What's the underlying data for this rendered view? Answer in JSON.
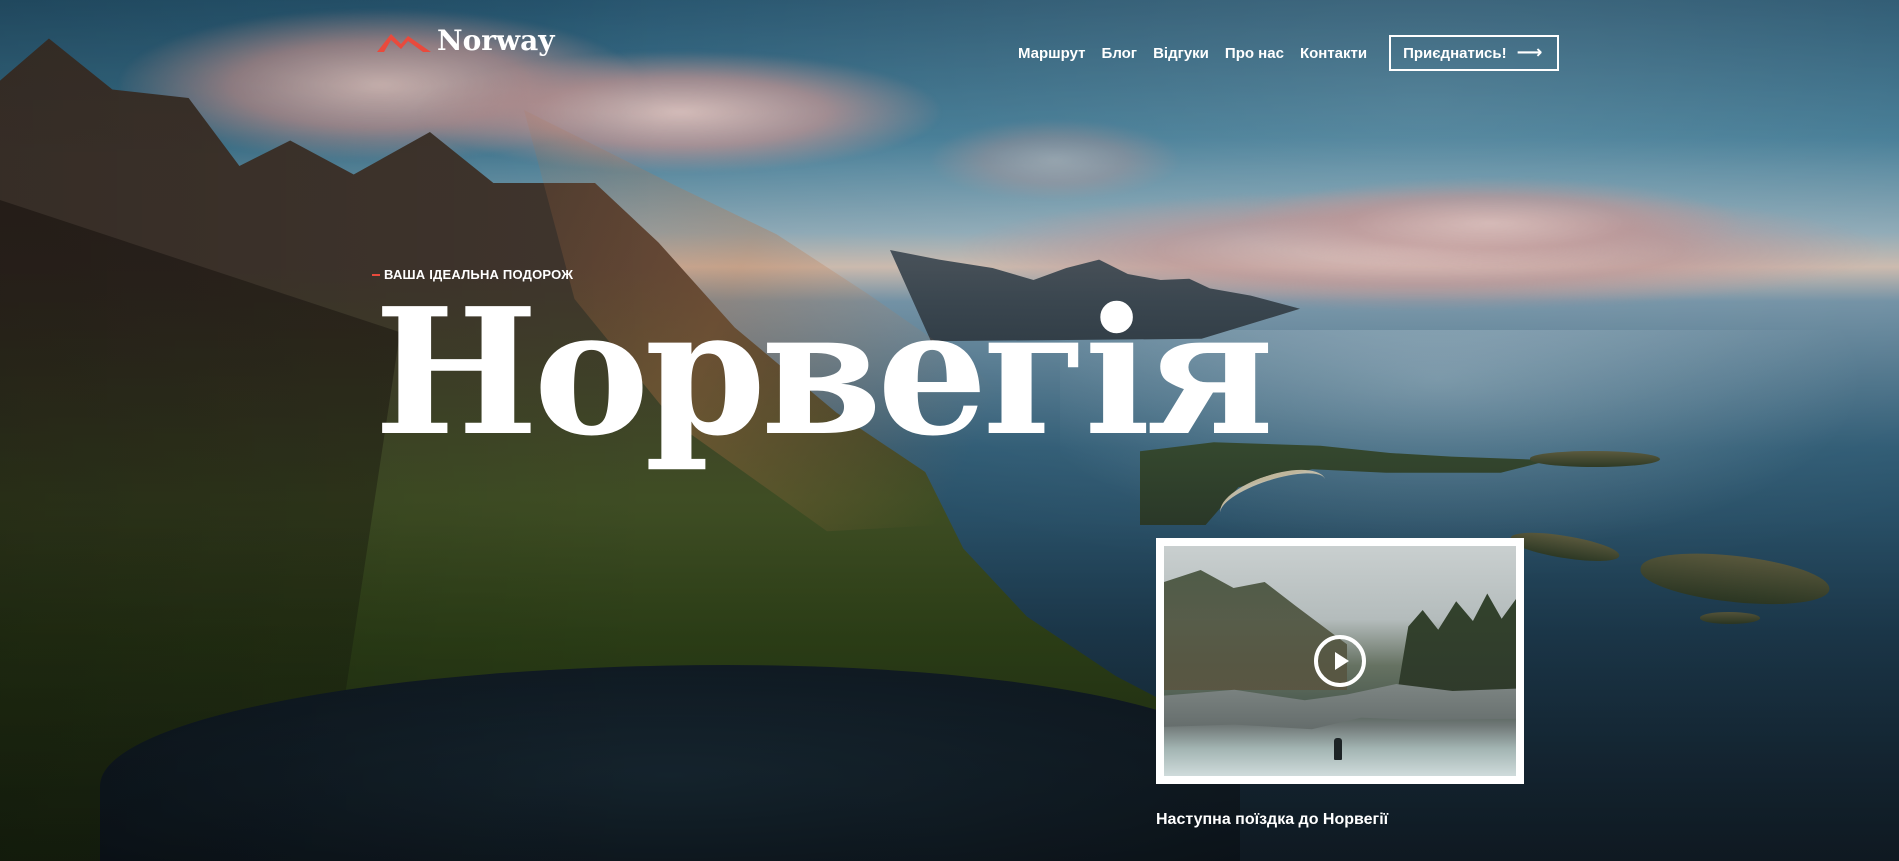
{
  "brand": {
    "name": "Norway",
    "accent_color": "#e94a3c",
    "icon": "mountain-logo-icon"
  },
  "nav": {
    "items": [
      {
        "label": "Маршрут"
      },
      {
        "label": "Блог"
      },
      {
        "label": "Відгуки"
      },
      {
        "label": "Про нас"
      },
      {
        "label": "Контакти"
      }
    ],
    "cta_label": "Приєднатись!",
    "cta_icon": "arrow-right-icon"
  },
  "hero": {
    "eyebrow": "ВАША ІДЕАЛЬНА ПОДОРОЖ",
    "title": "Норвегія"
  },
  "video": {
    "caption": "Наступна поїздка до Норвегії",
    "play_icon": "play-icon"
  }
}
